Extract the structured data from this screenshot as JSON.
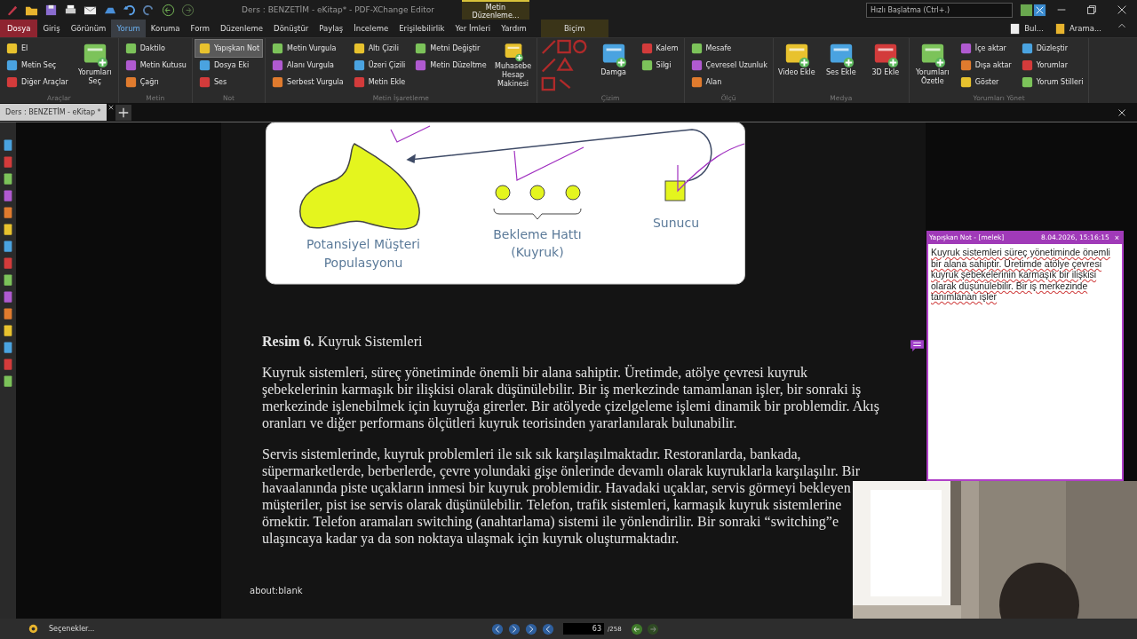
{
  "window": {
    "title": "Ders : BENZETİM - eKitap* - PDF-XChange Editor",
    "context_header": "Metin Düzenleme...",
    "search": {
      "placeholder": "Hızlı Başlatma (Ctrl+.)"
    }
  },
  "menu": [
    {
      "label": "Dosya",
      "kind": "file",
      "selected": false
    },
    {
      "label": "Giriş",
      "kind": "tab",
      "selected": false
    },
    {
      "label": "Görünüm",
      "kind": "tab",
      "selected": false
    },
    {
      "label": "Yorum",
      "kind": "tab",
      "selected": true
    },
    {
      "label": "Koruma",
      "kind": "tab",
      "selected": false
    },
    {
      "label": "Form",
      "kind": "tab",
      "selected": false
    },
    {
      "label": "Düzenleme",
      "kind": "tab",
      "selected": false
    },
    {
      "label": "Dönüştür",
      "kind": "tab",
      "selected": false
    },
    {
      "label": "Paylaş",
      "kind": "tab",
      "selected": false
    },
    {
      "label": "İnceleme",
      "kind": "tab",
      "selected": false
    },
    {
      "label": "Erişilebilirlik",
      "kind": "tab",
      "selected": false
    },
    {
      "label": "Yer İmleri",
      "kind": "tab",
      "selected": false
    },
    {
      "label": "Yardım",
      "kind": "tab",
      "selected": false
    },
    {
      "label": "Biçim",
      "kind": "context",
      "selected": false
    }
  ],
  "menu_right": [
    "Bul...",
    "Arama..."
  ],
  "ribbon": [
    {
      "label": "Araçlar",
      "items": [
        {
          "label": "El",
          "kind": "small",
          "selected": false
        },
        {
          "label": "Metin Seç",
          "kind": "small",
          "selected": false
        },
        {
          "label": "Diğer Araçlar",
          "kind": "small",
          "selected": false
        },
        {
          "label": "Yorumları Seç",
          "kind": "big",
          "selected": false
        }
      ]
    },
    {
      "label": "Metin",
      "items": [
        {
          "label": "Daktilo",
          "kind": "small",
          "selected": false
        },
        {
          "label": "Metin Kutusu",
          "kind": "small",
          "selected": false
        },
        {
          "label": "Çağrı",
          "kind": "small",
          "selected": false
        }
      ]
    },
    {
      "label": "Not",
      "items": [
        {
          "label": "Yapışkan Not",
          "kind": "small",
          "selected": true
        },
        {
          "label": "Dosya Eki",
          "kind": "small",
          "selected": false
        },
        {
          "label": "Ses",
          "kind": "small",
          "selected": false
        }
      ]
    },
    {
      "label": "Metin İşaretleme",
      "items": [
        {
          "label": "Metin Vurgula",
          "kind": "small",
          "selected": false
        },
        {
          "label": "Alanı Vurgula",
          "kind": "small",
          "selected": false
        },
        {
          "label": "Serbest Vurgula",
          "kind": "small",
          "selected": false
        },
        {
          "label": "Altı Çizili",
          "kind": "small",
          "selected": false
        },
        {
          "label": "Üzeri Çizili",
          "kind": "small",
          "selected": false
        },
        {
          "label": "Metin Ekle",
          "kind": "small",
          "selected": false
        },
        {
          "label": "Metni Değiştir",
          "kind": "small",
          "selected": false
        },
        {
          "label": "Metin Düzeltme",
          "kind": "small",
          "selected": false
        },
        {
          "kind": "blank"
        },
        {
          "label": "Muhasebe Hesap Makinesi",
          "kind": "big",
          "selected": false
        }
      ]
    },
    {
      "label": "Çizim",
      "items": [
        {
          "kind": "shapes"
        },
        {
          "label": "Damga",
          "kind": "big",
          "selected": false
        },
        {
          "label": "Kalem",
          "kind": "small",
          "selected": false
        },
        {
          "label": "Silgi",
          "kind": "small",
          "selected": false
        }
      ]
    },
    {
      "label": "Ölçü",
      "items": [
        {
          "label": "Mesafe",
          "kind": "small",
          "selected": false
        },
        {
          "label": "Çevresel Uzunluk",
          "kind": "small",
          "selected": false
        },
        {
          "label": "Alan",
          "kind": "small",
          "selected": false
        }
      ]
    },
    {
      "label": "Medya",
      "items": [
        {
          "label": "Video Ekle",
          "kind": "big",
          "selected": false
        },
        {
          "label": "Ses Ekle",
          "kind": "big",
          "selected": false
        },
        {
          "label": "3D Ekle",
          "kind": "big",
          "selected": false
        }
      ]
    },
    {
      "label": "Yorumları Yönet",
      "items": [
        {
          "label": "Yorumları Özetle",
          "kind": "big",
          "selected": false
        },
        {
          "label": "İçe aktar",
          "kind": "small",
          "selected": false
        },
        {
          "label": "Dışa aktar",
          "kind": "small",
          "selected": false
        },
        {
          "label": "Göster",
          "kind": "small",
          "selected": false
        },
        {
          "label": "Düzleştir",
          "kind": "small",
          "selected": false
        },
        {
          "label": "Yorumlar",
          "kind": "small",
          "selected": false
        },
        {
          "label": "Yorum Stilleri",
          "kind": "small",
          "selected": false
        }
      ]
    }
  ],
  "doc_tab": {
    "label": "Ders : BENZETİM - eKitap *",
    "selected": true
  },
  "figure": {
    "labels": [
      "Potansiyel Müşteri",
      "Populasyonu",
      "Bekleme Hattı",
      "(Kuyruk)",
      "Sunucu"
    ]
  },
  "document": {
    "caption": "**Resim 6.** Kuyruk Sistemleri",
    "paragraphs": [
      {
        "lines": [
          "Kuyruk sistemleri, süreç yönetiminde önemli bir alana sahiptir. Üretimde, atölye çevresi kuyruk",
          "şebekelerinin karmaşık bir ilişkisi olarak düşünülebilir. Bir iş merkezinde tamamlanan işler, bir sonraki iş",
          "merkezinde işlenebilmek için kuyruğa girerler. Bir atölyede çizelgeleme işlemi dinamik bir problemdir. Akış",
          "oranları ve diğer performans ölçütleri kuyruk teorisinden yararlanılarak bulunabilir."
        ]
      },
      {
        "lines": [
          "Servis sistemlerinde, kuyruk problemleri ile sık sık karşılaşılmaktadır. Restoranlarda, bankada,",
          "süpermarketlerde, berberlerde, çevre yolundaki gişe önlerinde devamlı olarak kuyruklarla karşılaşılır. Bir",
          "havaalanında piste uçakların inmesi bir kuyruk problemidir. Havadaki uçaklar, servis görmeyi bekleyen",
          "müşteriler, pist ise servis olarak düşünülebilir. Telefon, trafik sistemleri, karmaşık kuyruk sistemlerine",
          "örnektir. Telefon aramaları switching (anahtarlama) sistemi ile yönlendirilir. Bir sonraki “switching”e",
          "ulaşıncaya kadar ya da son noktaya ulaşmak için kuyruk oluşturmaktadır."
        ]
      }
    ],
    "footer": "about:blank"
  },
  "sticky_note": {
    "title": "Yapışkan Not - [melek]",
    "date": "8.04.2026, 15:16:15",
    "close": "×",
    "text": "Kuyruk sistemleri süreç yönetiminde önemli bir alana sahiptir. Üretimde atölye çevresi kuyruk şebekelerinin karmaşık bir ilişkisi olarak düşünülebilir. Bir  iş merkezinde tanımlanan işler"
  },
  "status_bar": {
    "options": "Seçenekler...",
    "page": "63",
    "page_count": "/258"
  },
  "webcam": {
    "kind": "picture"
  }
}
